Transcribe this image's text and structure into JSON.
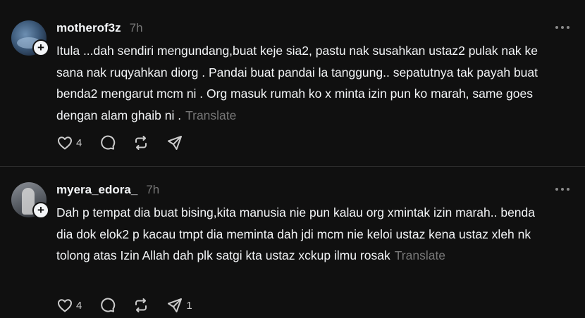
{
  "posts": [
    {
      "username": "motherof3z",
      "time": "7h",
      "text": "Itula ...dah sendiri mengundang,buat keje sia2, pastu nak susahkan ustaz2 pulak nak ke sana nak ruqyahkan diorg . Pandai buat pandai la tanggung.. sepatutnya tak payah buat benda2 mengarut mcm ni . Org masuk rumah ko x minta izin pun ko marah, same goes dengan alam ghaib ni .",
      "translate_label": "Translate",
      "like_count": "4",
      "share_count": ""
    },
    {
      "username": "myera_edora_",
      "time": "7h",
      "text": "Dah p tempat dia buat bising,kita manusia nie pun kalau org xmintak izin marah.. benda dia dok elok2 p kacau tmpt dia meminta dah jdi mcm nie keloi ustaz kena ustaz xleh nk tolong atas Izin Allah dah plk satgi kta ustaz xckup ilmu rosak",
      "translate_label": "Translate",
      "like_count": "4",
      "share_count": "1"
    }
  ],
  "icons": {
    "like": "heart-icon",
    "comment": "comment-icon",
    "repost": "repost-icon",
    "share": "send-icon",
    "more": "more-icon",
    "follow": "plus-icon"
  },
  "colors": {
    "background": "#101010",
    "text": "#f3f5f7",
    "muted": "#777777",
    "divider": "#2e2e2e"
  }
}
